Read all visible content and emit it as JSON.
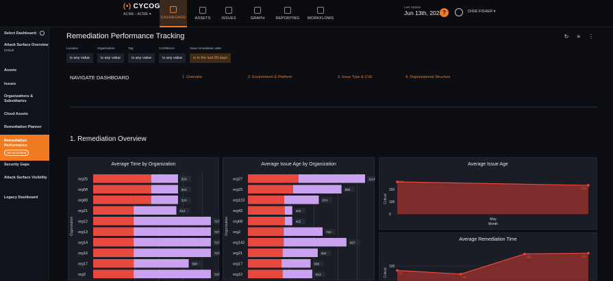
{
  "topbar": {
    "brand": "CYCOGNITO",
    "org_path": "ACME › ACME",
    "nav": [
      {
        "label": "DASHBOARD",
        "active": true
      },
      {
        "label": "ASSETS",
        "active": false
      },
      {
        "label": "ISSUES",
        "active": false
      },
      {
        "label": "GRAPH",
        "active": false
      },
      {
        "label": "REPORTING",
        "active": false
      },
      {
        "label": "WORKFLOWS",
        "active": false
      }
    ],
    "last_update_label": "Last Update",
    "last_update_value": "Jun 13th, 2021",
    "user": "DIXIE FISHER"
  },
  "sidebar": {
    "select_label": "Select Dashboard:",
    "items": [
      {
        "label": "Attack Surface Overview",
        "sub": "Default"
      },
      {
        "label": "Assets"
      },
      {
        "label": "Issues"
      },
      {
        "label": "Organizations & Subsidiaries"
      },
      {
        "label": "Cloud Assets"
      },
      {
        "label": "Remediation Planner"
      },
      {
        "label": "Remediation Performance",
        "button": "Set as Default",
        "active": true
      },
      {
        "label": "Security Gaps"
      },
      {
        "label": "Attack Surface Visibility"
      },
      {
        "label": "Legacy Dashboard"
      }
    ]
  },
  "main": {
    "title": "Remediation Performance Tracking",
    "filters": [
      {
        "label": "Location",
        "value": "is any value"
      },
      {
        "label": "Organization",
        "value": "is any value"
      },
      {
        "label": "Tag",
        "value": "is any value"
      },
      {
        "label": "Confidence",
        "value": "is any value"
      },
      {
        "label": "Issue remediation date",
        "value": "is in the last 90 days"
      }
    ],
    "navigate_label": "NAVIGATE DASHBOARD",
    "nav_links": [
      "1. Overview",
      "2. Environment & Platform",
      "3. Issue Type & CVE",
      "4. Organizational Structure"
    ],
    "section_title": "1. Remediation Overview"
  },
  "chart_data": [
    {
      "type": "bar",
      "title": "Average Time by Organization",
      "ylabel": "Organization",
      "categories": [
        "org25",
        "org58",
        "org60",
        "org21",
        "org12",
        "org13",
        "org14",
        "org16",
        "org17",
        "org2"
      ],
      "series": [
        {
          "name": "",
          "color": "#e8493f",
          "values": [
            358,
            358,
            358,
            250,
            250,
            250,
            250,
            250,
            250,
            250
          ]
        },
        {
          "name": "",
          "color": "#c9a2f0",
          "values": [
            166,
            166,
            166,
            264,
            477,
            477,
            477,
            477,
            340,
            477
          ]
        }
      ],
      "totals": [
        524,
        524,
        524,
        514,
        727,
        727,
        727,
        727,
        590,
        727
      ]
    },
    {
      "type": "bar",
      "title": "Average Issue Age by Organization",
      "ylabel": "Organization",
      "categories": [
        "org27",
        "org23",
        "org123",
        "org43",
        "org68",
        "org2",
        "org142",
        "org21",
        "org17",
        "org12"
      ],
      "series": [
        {
          "name": "",
          "color": "#e8493f",
          "values": [
            480,
            430,
            345,
            350,
            350,
            340,
            340,
            330,
            320,
            330
          ]
        },
        {
          "name": "",
          "color": "#c9a2f0",
          "values": [
            634,
            460,
            329,
            72,
            72,
            370,
            597,
            334,
            276,
            282
          ]
        }
      ],
      "totals": [
        1114,
        890,
        674,
        422,
        422,
        710,
        937,
        664,
        596,
        612
      ]
    },
    {
      "type": "area",
      "title": "Average Issue Age",
      "ylabel": "Critical",
      "xlabel": "Month",
      "x_tick": "May",
      "y_ticks": [
        0,
        100,
        200
      ],
      "values": [
        262,
        234
      ]
    },
    {
      "type": "area",
      "title": "Average Remediation Time",
      "ylabel": "Critical",
      "y_ticks": [
        100
      ],
      "values": [
        70,
        46,
        180,
        185
      ]
    }
  ]
}
